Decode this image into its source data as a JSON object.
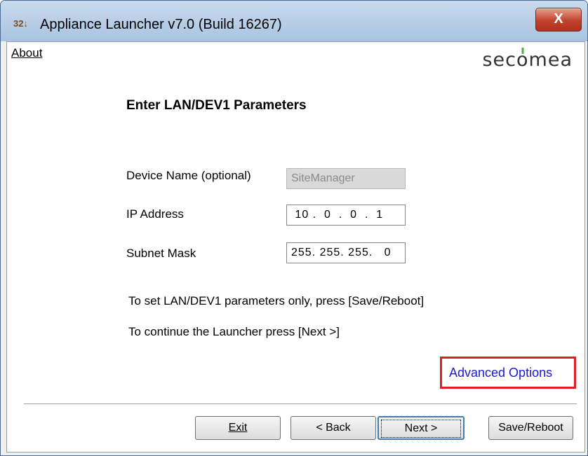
{
  "window": {
    "title": "Appliance Launcher v7.0 (Build 16267)",
    "icon": "app-icon",
    "close_label": "X"
  },
  "menu": {
    "about": "About"
  },
  "logo": {
    "text_before": "sec",
    "text_o": "o",
    "text_after": "mea"
  },
  "page": {
    "title": "Enter LAN/DEV1 Parameters",
    "fields": {
      "device_name_label": "Device Name (optional)",
      "device_name_value": "SiteManager",
      "ip_label": "IP Address",
      "ip_value": " 10 .  0  .  0  .  1",
      "subnet_label": "Subnet Mask",
      "subnet_value": "255. 255. 255.   0"
    },
    "info_line1": "To set LAN/DEV1 parameters only, press [Save/Reboot]",
    "info_line2": "To continue the Launcher press [Next >]",
    "advanced_link": "Advanced Options"
  },
  "buttons": {
    "exit": "Exit",
    "back": "< Back",
    "next": "Next >",
    "save_reboot": "Save/Reboot"
  },
  "colors": {
    "highlight_box": "#e02020",
    "link": "#1a1ad6",
    "logo_accent": "#4caf50"
  }
}
